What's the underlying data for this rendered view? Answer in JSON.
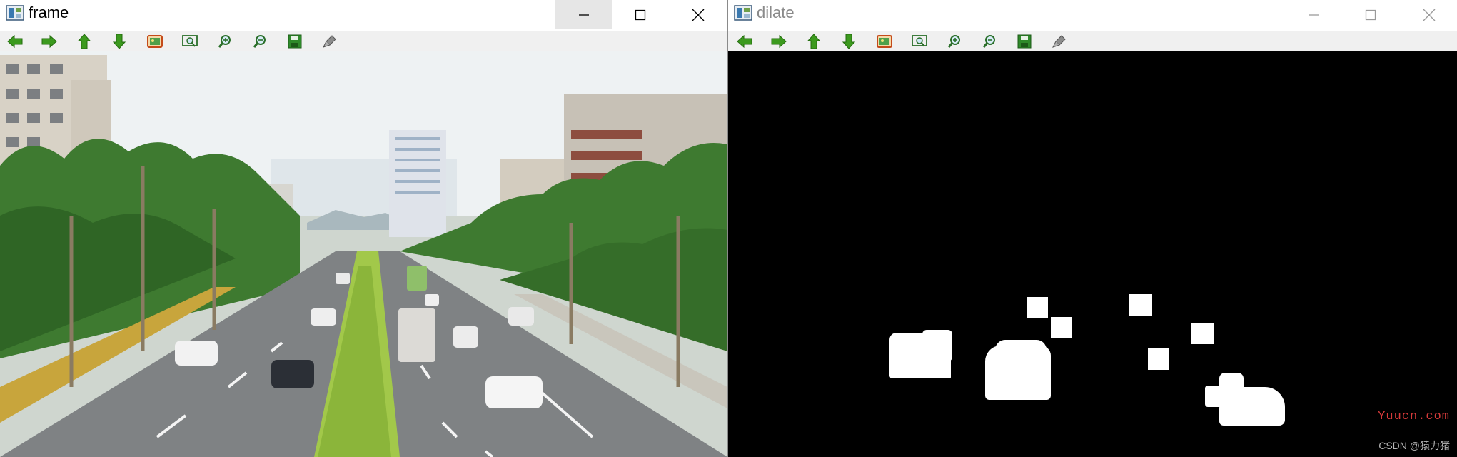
{
  "windows": [
    {
      "title": "frame",
      "controls": [
        "minimize-icon",
        "maximize-icon",
        "close-icon"
      ],
      "toolbar": [
        "arrow-left-icon",
        "arrow-right-icon",
        "arrow-up-icon",
        "arrow-down-icon",
        "image-icon",
        "zoom-fit-icon",
        "zoom-in-icon",
        "zoom-out-icon",
        "save-icon",
        "properties-icon"
      ]
    },
    {
      "title": "dilate",
      "controls": [
        "minimize-icon",
        "maximize-icon",
        "close-icon"
      ],
      "toolbar": [
        "arrow-left-icon",
        "arrow-right-icon",
        "arrow-up-icon",
        "arrow-down-icon",
        "image-icon",
        "zoom-fit-icon",
        "zoom-in-icon",
        "zoom-out-icon",
        "save-icon",
        "properties-icon"
      ]
    }
  ],
  "watermarks": {
    "site": "Yuucn.com",
    "author": "CSDN @猿力猪"
  },
  "colors": {
    "toolbar_bg": "#f0f0f0",
    "arrow_green": "#3c9a1e",
    "mask_bg": "#000000",
    "mask_fg": "#ffffff",
    "watermark_red": "#d43a3a"
  }
}
